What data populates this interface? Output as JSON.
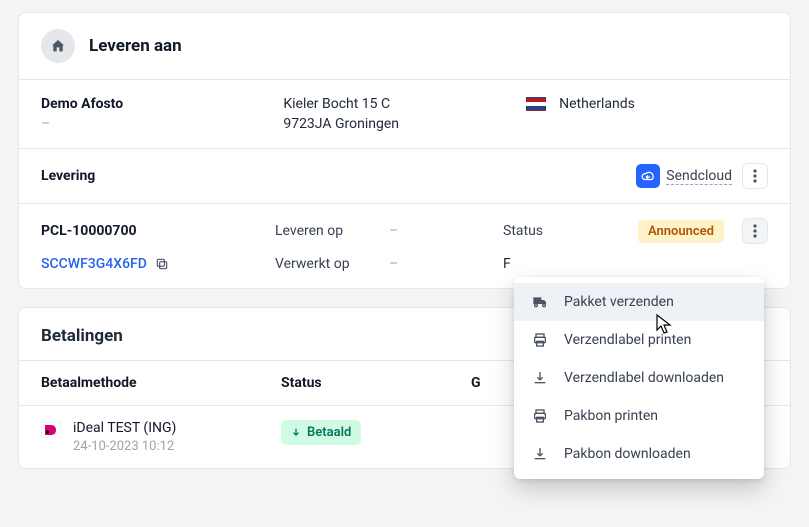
{
  "deliver": {
    "title": "Leveren aan",
    "name": "Demo Afosto",
    "name_sub": "–",
    "addr_line1": "Kieler Bocht 15 C",
    "addr_line2": "9723JA Groningen",
    "country": "Netherlands",
    "levering_label": "Levering",
    "provider": "Sendcloud",
    "ref": "PCL-10000700",
    "deliver_on_label": "Leveren op",
    "deliver_on_value": "–",
    "processed_on_label": "Verwerkt op",
    "processed_on_value": "–",
    "status_label": "Status",
    "status_badge": "Announced",
    "tracking": "SCCWF3G4X6FD",
    "cutoff": "F"
  },
  "payments": {
    "title": "Betalingen",
    "col_method": "Betaalmethode",
    "col_status": "Status",
    "col_other": "G",
    "method_name": "iDeal TEST (ING)",
    "method_date": "24-10-2023 10:12",
    "paid_badge": "Betaald"
  },
  "menu": {
    "items": [
      {
        "label": "Pakket verzenden",
        "icon": "truck"
      },
      {
        "label": "Verzendlabel printen",
        "icon": "print"
      },
      {
        "label": "Verzendlabel downloaden",
        "icon": "download"
      },
      {
        "label": "Pakbon printen",
        "icon": "print"
      },
      {
        "label": "Pakbon downloaden",
        "icon": "download"
      }
    ]
  }
}
